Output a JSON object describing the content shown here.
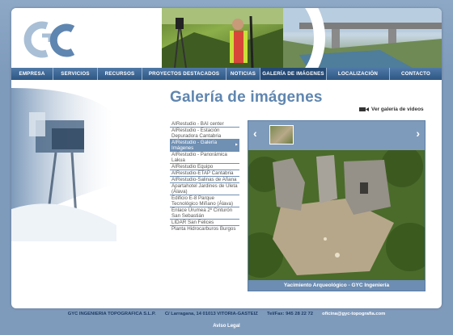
{
  "nav": {
    "items": [
      {
        "label": "EMPRESA"
      },
      {
        "label": "SERVICIOS"
      },
      {
        "label": "RECURSOS"
      },
      {
        "label": "PROYECTOS DESTACADOS"
      },
      {
        "label": "NOTICIAS"
      },
      {
        "label": "GALERÍA DE IMÁGENES"
      },
      {
        "label": "LOCALIZACIÓN"
      },
      {
        "label": "CONTACTO"
      }
    ],
    "active": "GALERÍA DE IMÁGENES"
  },
  "page": {
    "title": "Galería de imágenes",
    "video_link": "Ver galería de videos"
  },
  "gallery_list": [
    {
      "label": "AIRestudio - BAI center"
    },
    {
      "label": "AIRestudio - Estación Depuradora Cantabria"
    },
    {
      "label": "AIRestudio - Galería Imágenes",
      "active": true
    },
    {
      "label": "AIRestudio - Panorámica Lakua"
    },
    {
      "label": "AIRestudio Equipo"
    },
    {
      "label": "AIRestudio-ETAP Cantabria"
    },
    {
      "label": "AIRestudio-Salinas de Añana"
    },
    {
      "label": "Apartahotel Jardines de Uleta (Álava)"
    },
    {
      "label": "Edificio E-8 Parque Tecnológico Miñano (Álava)"
    },
    {
      "label": "Enlace Urumea 2º Cinturón San Sebastián"
    },
    {
      "label": "LIDAR San Felices"
    },
    {
      "label": "Planta Hidrocarburos Burgos"
    }
  ],
  "viewer": {
    "caption": "Yacimiento Arqueológico - GYC Ingeniería",
    "prev_symbol": "‹",
    "next_symbol": "›"
  },
  "footer": {
    "company": "GYC INGENIERIA TOPOGRAFICA S.L.P.",
    "address": "C/ Larragana, 14   01013   VITORIA-GASTEIZ",
    "phone": "Tel/Fax: 945 28 22 72",
    "email": "oficina@gyc-topografia.com",
    "legal": "Aviso Legal"
  },
  "colors": {
    "background": "#7f9bbc",
    "nav": "#3a6494",
    "accent_title": "#5f86b0",
    "active_item": "#6f8fb3"
  }
}
